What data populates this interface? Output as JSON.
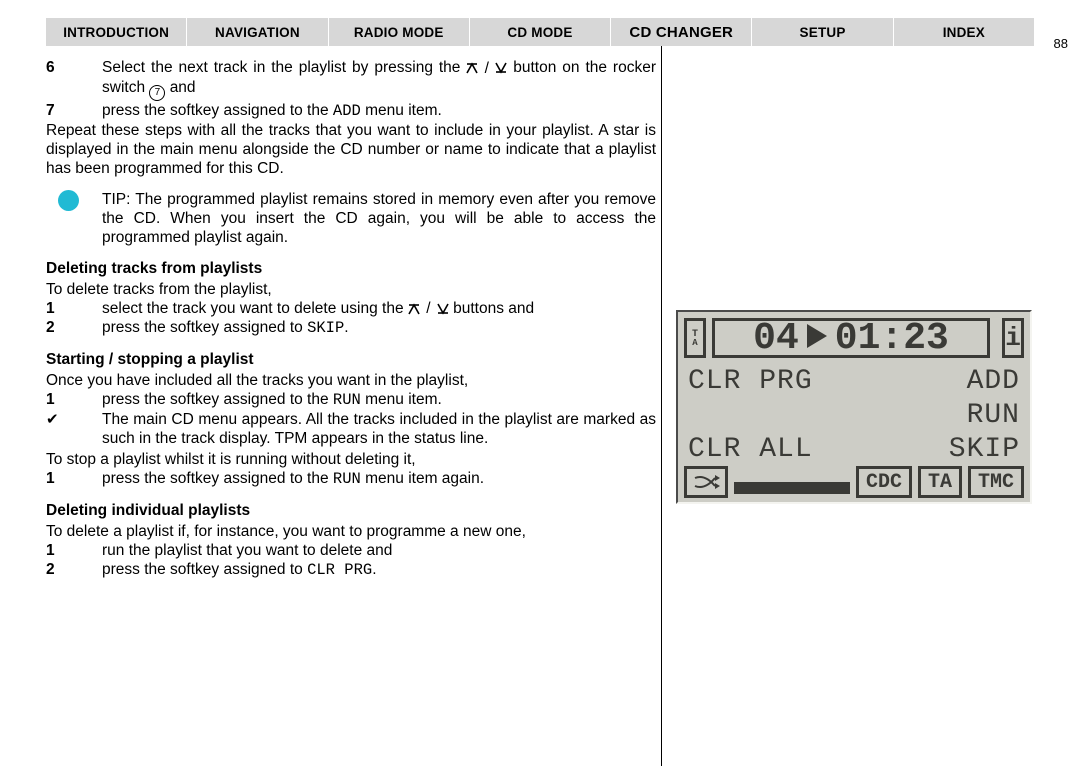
{
  "nav": {
    "items": [
      {
        "label": "Introduction"
      },
      {
        "label": "Navigation"
      },
      {
        "label": "Radio Mode"
      },
      {
        "label": "Cd Mode"
      },
      {
        "label": "Cd Changer"
      },
      {
        "label": "Setup"
      },
      {
        "label": "Index"
      }
    ],
    "active_index": 4
  },
  "page_number": "88",
  "body": {
    "step6_num": "6",
    "step6_text_a": "Select the next track in the playlist by pressing the ",
    "step6_text_b": " button on the rocker switch ",
    "step6_text_c": " and",
    "circled_7": "7",
    "step7_num": "7",
    "step7_text_a": "press the softkey assigned to the ",
    "step7_add": "ADD",
    "step7_text_b": " menu item.",
    "repeat_para": "Repeat these steps with all the tracks that you want to include in your playlist. A star is displayed in the main menu alongside the CD number or name to indicate that a playlist has been programmed for this CD.",
    "tip_text": "TIP: The programmed playlist remains stored in memory even after you remove the CD. When you insert the CD again, you will be able to access the programmed playlist again.",
    "subhead_del_tracks": "Deleting tracks from playlists",
    "del_intro": "To delete tracks from the playlist,",
    "del1_num": "1",
    "del1_text_a": "select the track you want to delete using the ",
    "del1_text_b": " buttons and",
    "del2_num": "2",
    "del2_text_a": "press the softkey assigned to ",
    "del2_skip": "SKIP",
    "del2_text_b": ".",
    "subhead_startstop": "Starting / stopping a playlist",
    "ss_intro": "Once you have included all the tracks you want in the playlist,",
    "ss1_num": "1",
    "ss1_text_a": "press the softkey assigned to the ",
    "ss1_run": "RUN",
    "ss1_text_b": " menu item.",
    "check_mark": "✔",
    "check_text": "The main CD menu appears. All the tracks included in the playlist are marked as such in the track display. TPM appears in the status line.",
    "stop_intro": "To stop a playlist whilst it is running without deleting it,",
    "stop1_num": "1",
    "stop1_text_a": "press the softkey assigned to the ",
    "stop1_run": "RUN",
    "stop1_text_b": " menu item again.",
    "subhead_del_pl": "Deleting individual playlists",
    "delpl_intro": "To delete a playlist if, for instance, you want to programme a new one,",
    "delpl1_num": "1",
    "delpl1_text": "run the playlist that you want to delete and",
    "delpl2_num": "2",
    "delpl2_text_a": "press the softkey assigned to ",
    "delpl2_clrprg": "CLR PRG",
    "delpl2_text_b": "."
  },
  "lcd": {
    "ta_small": "TA",
    "track": "04",
    "time": "01:23",
    "info_i": "i",
    "line1_left": "CLR PRG",
    "line1_right": "ADD",
    "line2_left": "",
    "line2_right": "RUN",
    "line3_left": "CLR ALL",
    "line3_right": "SKIP",
    "cdc": "CDC",
    "ta": "TA",
    "tmc": "TMC"
  }
}
